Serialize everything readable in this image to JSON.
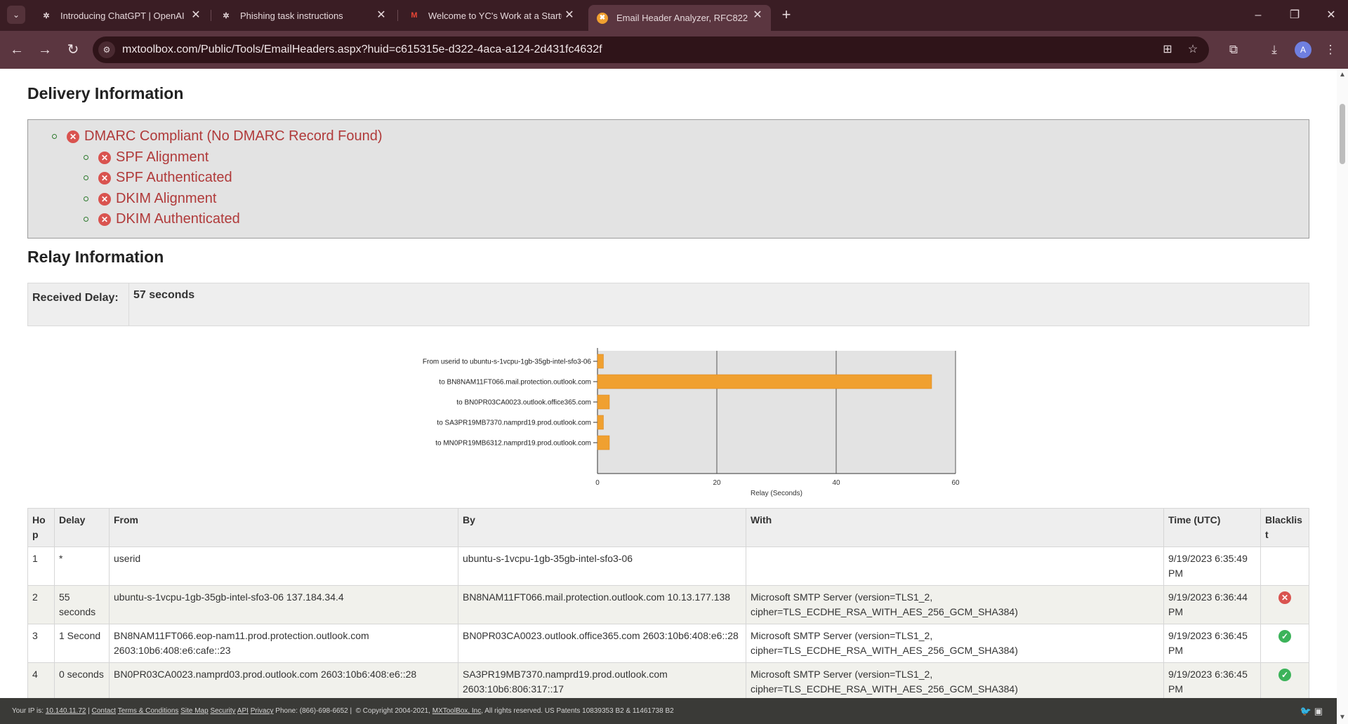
{
  "browser": {
    "tabs": [
      {
        "title": "Introducing ChatGPT | OpenAI",
        "icon": "openai-icon"
      },
      {
        "title": "Phishing task instructions",
        "icon": "openai-icon"
      },
      {
        "title": "Welcome to YC's Work at a Startup",
        "icon": "gmail-icon"
      },
      {
        "title": "Email Header Analyzer, RFC822 Parser",
        "icon": "mxtoolbox-icon"
      }
    ],
    "url": "mxtoolbox.com/Public/Tools/EmailHeaders.aspx?huid=c615315e-d322-4aca-a124-2d431fc4632f",
    "profile_initial": "A"
  },
  "delivery": {
    "title": "Delivery Information",
    "dmarc": "DMARC Compliant (No DMARC Record Found)",
    "checks": [
      "SPF Alignment",
      "SPF Authenticated",
      "DKIM Alignment",
      "DKIM Authenticated"
    ]
  },
  "relay": {
    "title": "Relay Information",
    "received_delay_label": "Received Delay:",
    "received_delay_value": "57 seconds"
  },
  "chart_data": {
    "type": "bar",
    "orientation": "horizontal",
    "categories": [
      "From  userid  to  ubuntu-s-1vcpu-1gb-35gb-intel-sfo3-06",
      "to  BN8NAM11FT066.mail.protection.outlook.com",
      "to  BN0PR03CA0023.outlook.office365.com",
      "to  SA3PR19MB7370.namprd19.prod.outlook.com",
      "to  MN0PR19MB6312.namprd19.prod.outlook.com"
    ],
    "values": [
      1,
      56,
      2,
      1,
      2
    ],
    "xlabel": "Relay (Seconds)",
    "xlim": [
      0,
      60
    ],
    "xticks": [
      "0",
      "20",
      "40",
      "60"
    ],
    "grid": true,
    "colors": {
      "bar": "#f0a030",
      "plot_bg": "#e3e3e3"
    }
  },
  "hops_table": {
    "headers": [
      "Ho p",
      "Delay",
      "From",
      "By",
      "With",
      "Time (UTC)",
      "Blacklis t"
    ],
    "rows": [
      {
        "hop": "1",
        "delay": "*",
        "from": "userid",
        "by": "ubuntu-s-1vcpu-1gb-35gb-intel-sfo3-06",
        "with": "",
        "time": "9/19/2023 6:35:49 PM",
        "blacklist": ""
      },
      {
        "hop": "2",
        "delay": "55 seconds",
        "from": "ubuntu-s-1vcpu-1gb-35gb-intel-sfo3-06 137.184.34.4",
        "by": "BN8NAM11FT066.mail.protection.outlook.com 10.13.177.138",
        "with": "Microsoft SMTP Server (version=TLS1_2, cipher=TLS_ECDHE_RSA_WITH_AES_256_GCM_SHA384)",
        "time": "9/19/2023 6:36:44 PM",
        "blacklist": "error"
      },
      {
        "hop": "3",
        "delay": "1 Second",
        "from": "BN8NAM11FT066.eop-nam11.prod.protection.outlook.com 2603:10b6:408:e6:cafe::23",
        "by": "BN0PR03CA0023.outlook.office365.com 2603:10b6:408:e6::28",
        "with": "Microsoft SMTP Server (version=TLS1_2, cipher=TLS_ECDHE_RSA_WITH_AES_256_GCM_SHA384)",
        "time": "9/19/2023 6:36:45 PM",
        "blacklist": "ok"
      },
      {
        "hop": "4",
        "delay": "0 seconds",
        "from": "BN0PR03CA0023.namprd03.prod.outlook.com 2603:10b6:408:e6::28",
        "by": "SA3PR19MB7370.namprd19.prod.outlook.com 2603:10b6:806:317::17",
        "with": "Microsoft SMTP Server (version=TLS1_2, cipher=TLS_ECDHE_RSA_WITH_AES_256_GCM_SHA384)",
        "time": "9/19/2023 6:36:45 PM",
        "blacklist": "ok"
      }
    ]
  },
  "footer": {
    "ip_label": "Your IP is:",
    "ip": "10.140.11.72",
    "links": [
      "Contact",
      "Terms & Conditions",
      "Site Map",
      "Security",
      "API",
      "Privacy"
    ],
    "phone": "Phone: (866)-698-6652 |",
    "copyright": "© Copyright 2004-2021,",
    "company": "MXToolBox, Inc",
    "rights": ", All rights reserved. US Patents 10839353 B2 & 11461738 B2"
  }
}
